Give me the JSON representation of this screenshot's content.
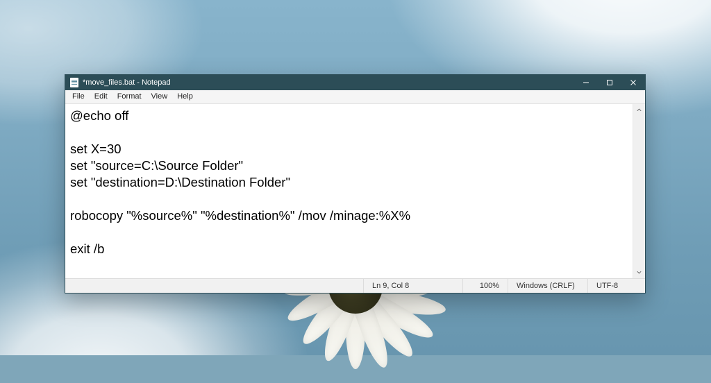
{
  "titlebar": {
    "title": "*move_files.bat - Notepad"
  },
  "menu": {
    "file": "File",
    "edit": "Edit",
    "format": "Format",
    "view": "View",
    "help": "Help"
  },
  "editor": {
    "content": "@echo off\n\nset X=30\nset \"source=C:\\Source Folder\"\nset \"destination=D:\\Destination Folder\"\n\nrobocopy \"%source%\" \"%destination%\" /mov /minage:%X%\n\nexit /b"
  },
  "status": {
    "position": "Ln 9, Col 8",
    "zoom": "100%",
    "line_ending": "Windows (CRLF)",
    "encoding": "UTF-8"
  }
}
